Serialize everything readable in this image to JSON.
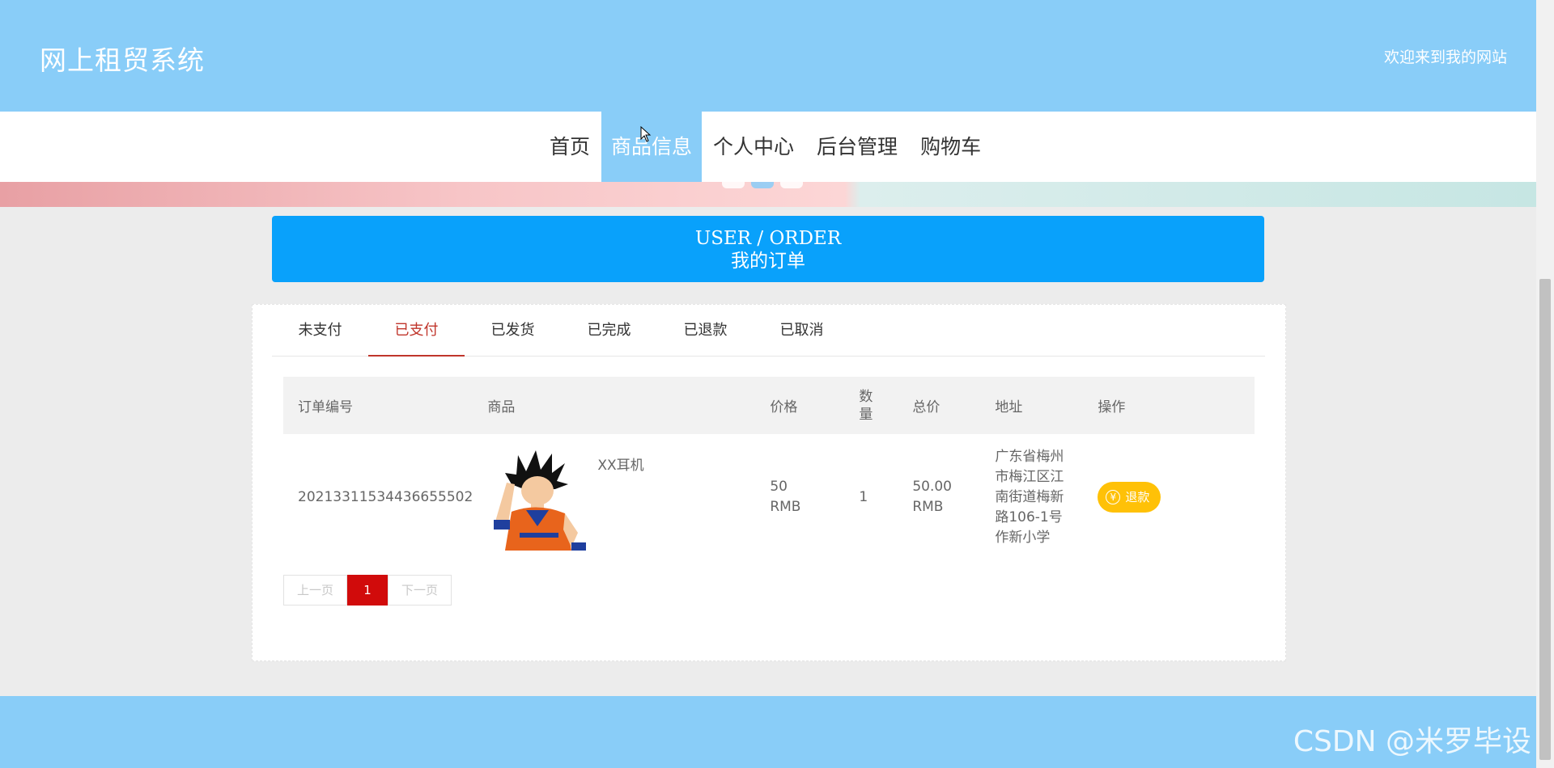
{
  "header": {
    "site_title": "网上租贸系统",
    "welcome": "欢迎来到我的网站"
  },
  "nav": {
    "items": [
      {
        "label": "首页",
        "active": false
      },
      {
        "label": "商品信息",
        "active": true
      },
      {
        "label": "个人中心",
        "active": false
      },
      {
        "label": "后台管理",
        "active": false
      },
      {
        "label": "购物车",
        "active": false
      }
    ]
  },
  "page_banner": {
    "title_en": "USER / ORDER",
    "title_cn": "我的订单"
  },
  "tabs": [
    {
      "label": "未支付",
      "active": false
    },
    {
      "label": "已支付",
      "active": true
    },
    {
      "label": "已发货",
      "active": false
    },
    {
      "label": "已完成",
      "active": false
    },
    {
      "label": "已退款",
      "active": false
    },
    {
      "label": "已取消",
      "active": false
    }
  ],
  "table": {
    "headers": [
      "订单编号",
      "商品",
      "价格",
      "数量",
      "总价",
      "地址",
      "操作"
    ],
    "rows": [
      {
        "order_no": "20213311534436655502",
        "goods_name": "XX耳机",
        "price": "50 RMB",
        "quantity": "1",
        "total": "50.00 RMB",
        "address": "广东省梅州市梅江区江南街道梅新路106-1号作新小学",
        "action_label": "退款",
        "action_icon": "yen-icon"
      }
    ]
  },
  "pager": {
    "prev": "上一页",
    "current": "1",
    "next": "下一页"
  },
  "footer": {
    "watermark": "CSDN @米罗毕设"
  },
  "colors": {
    "header_bg": "#89cdf8",
    "banner_blue": "#09a1fb",
    "tab_active": "#c0352b",
    "refund": "#ffc107",
    "page_current": "#d10b0b"
  }
}
